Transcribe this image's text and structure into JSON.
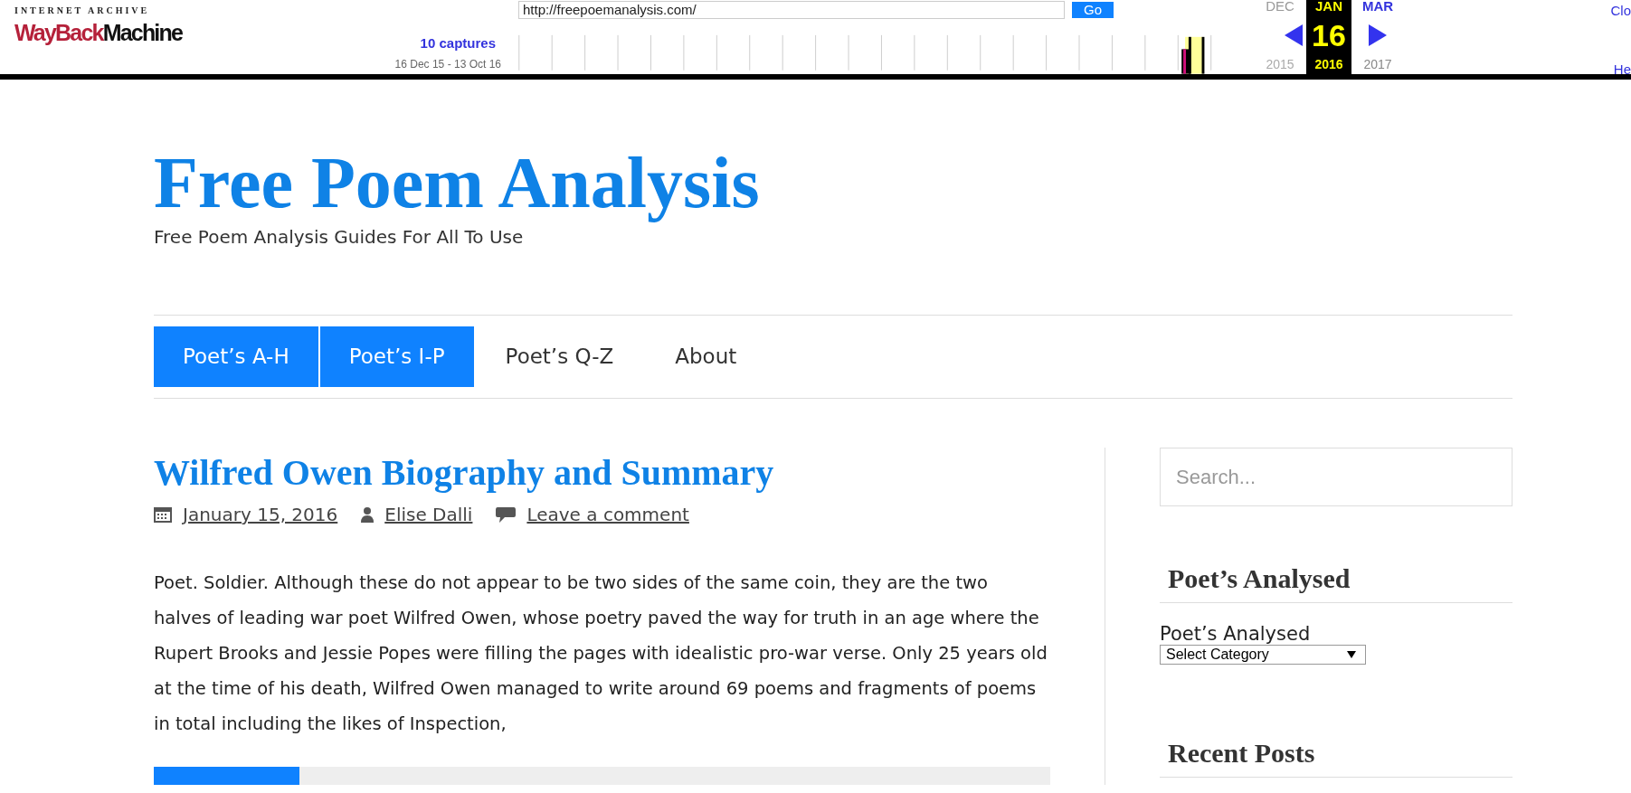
{
  "wayback_toolbar": {
    "logo_top": "INTERNET ARCHIVE",
    "logo_left": "WayBack",
    "logo_right": "Machine",
    "captures": "10 captures",
    "capture_range": "16 Dec 15 - 13 Oct 16",
    "url": "http://freepoemanalysis.com/",
    "go_button": "Go",
    "months": [
      {
        "month": "DEC",
        "year": "2015",
        "selected": false,
        "disabled": true,
        "kind": "prev"
      },
      {
        "month": "JAN",
        "day": "16",
        "year": "2016",
        "selected": true,
        "disabled": false,
        "kind": "current"
      },
      {
        "month": "MAR",
        "year": "2017",
        "selected": false,
        "disabled": false,
        "kind": "next"
      }
    ],
    "right_links": [
      "Clo",
      "He"
    ]
  },
  "site": {
    "title": "Free Poem Analysis",
    "tagline": "Free Poem Analysis Guides For All To Use"
  },
  "nav": [
    {
      "label": "Poet’s A-H",
      "selected": true
    },
    {
      "label": "Poet’s I-P",
      "selected": true
    },
    {
      "label": "Poet’s Q-Z",
      "selected": false
    },
    {
      "label": "About",
      "selected": false
    }
  ],
  "post": {
    "title": "Wilfred Owen Biography and Summary",
    "meta": [
      {
        "kind": "date",
        "text": "January 15, 2016"
      },
      {
        "kind": "author",
        "text": "Elise Dalli"
      },
      {
        "kind": "comments",
        "text": "Leave a comment"
      }
    ],
    "body": "Poet. Soldier. Although these do not appear to be two sides of the same coin, they are the two halves of leading war poet Wilfred Owen, whose poetry paved the way for truth in an age where the Rupert Brooks and Jessie Popes were filling the pages with idealistic pro-war verse. Only 25 years old at the time of his death, Wilfred Owen managed to write around 69 poems and fragments of poems in total including the likes of Inspection,"
  },
  "sidebar": {
    "search": {
      "placeholder": "Search..."
    },
    "widgets": [
      {
        "kind": "categories",
        "title": "Poet’s Analysed",
        "label": "Poet’s Analysed",
        "select": "Select Category"
      },
      {
        "kind": "recent",
        "title": "Recent Posts"
      }
    ]
  }
}
